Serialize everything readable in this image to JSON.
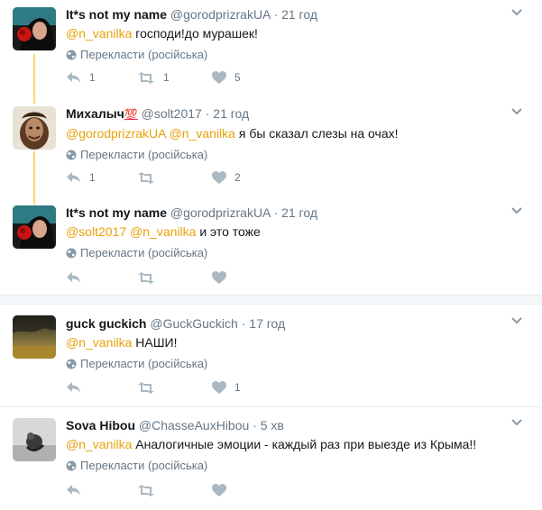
{
  "tweets": [
    {
      "name": "It*s not my name",
      "handle": "@gorodprizrakUA",
      "sep": "·",
      "time": "21 год",
      "mentions": [
        "@n_vanilka"
      ],
      "text": "господи!до мурашек!",
      "translate": "Перекласти (російська)",
      "reply": "1",
      "retweet": "1",
      "like": "5"
    },
    {
      "name": "Михалыч",
      "emoji": "💯",
      "handle": "@solt2017",
      "sep": "·",
      "time": "21 год",
      "mentions": [
        "@gorodprizrakUA",
        "@n_vanilka"
      ],
      "text": "я бы сказал слезы на очах!",
      "translate": "Перекласти (російська)",
      "reply": "1",
      "retweet": "",
      "like": "2"
    },
    {
      "name": "It*s not my name",
      "handle": "@gorodprizrakUA",
      "sep": "·",
      "time": "21 год",
      "mentions": [
        "@solt2017",
        "@n_vanilka"
      ],
      "text": "и это тоже",
      "translate": "Перекласти (російська)",
      "reply": "",
      "retweet": "",
      "like": ""
    },
    {
      "name": "guck guckich",
      "handle": "@GuckGuckich",
      "sep": "·",
      "time": "17 год",
      "mentions": [
        "@n_vanilka"
      ],
      "text": "НАШИ!",
      "translate": "Перекласти (російська)",
      "reply": "",
      "retweet": "",
      "like": "1"
    },
    {
      "name": "Sova Hibou",
      "handle": "@ChasseAuxHibou",
      "sep": "·",
      "time": "5 хв",
      "mentions": [
        "@n_vanilka"
      ],
      "text": "Аналогичные эмоции - каждый раз при выезде из Крыма!!",
      "translate": "Перекласти (російська)",
      "reply": "",
      "retweet": "",
      "like": ""
    }
  ],
  "icons": {
    "reply": "reply-icon",
    "retweet": "retweet-icon",
    "like": "heart-icon",
    "translate": "globe-icon",
    "menu": "chevron-down-icon"
  },
  "colors": {
    "mention": "#e8a20a",
    "muted": "#657786",
    "thread_line": "#ffd56b",
    "divider": "#e6ecf0"
  }
}
